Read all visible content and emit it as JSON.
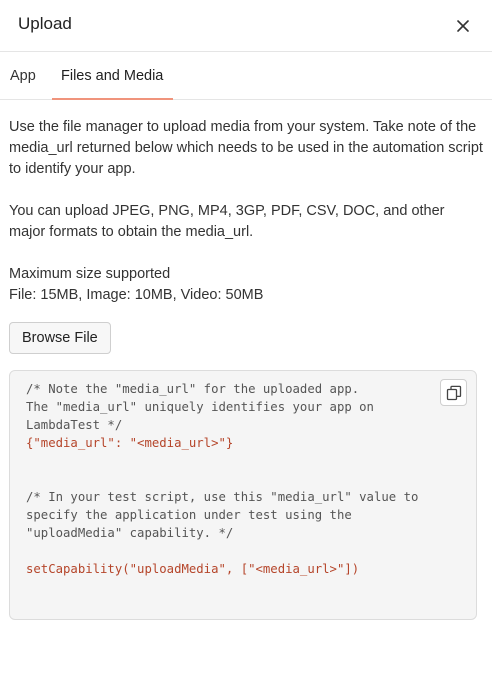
{
  "header": {
    "title": "Upload",
    "close_icon": "close-icon"
  },
  "tabs": [
    {
      "label": "App",
      "active": false
    },
    {
      "label": "Files and Media",
      "active": true
    }
  ],
  "content": {
    "paragraph1": "Use the file manager to upload media from your system. Take note of the media_url returned below which needs to be used in the automation script to identify your app.",
    "paragraph2": "You can upload JPEG, PNG, MP4, 3GP, PDF, CSV, DOC, and other major formats to obtain the media_url.",
    "max_size_label": "Maximum size supported",
    "max_size_values": "File: 15MB, Image: 10MB, Video: 50MB",
    "browse_label": "Browse File"
  },
  "code_block": {
    "copy_icon": "copy-icon",
    "comment1_line1": "/* Note the \"media_url\" for the uploaded app.",
    "comment1_line2": "The \"media_url\" uniquely identifies your app on",
    "comment1_line3": "LambdaTest */",
    "json_line": "{\"media_url\": \"<media_url>\"}",
    "comment2_line1": "/* In your test script, use this \"media_url\" value to",
    "comment2_line2": "specify the application under test using the",
    "comment2_line3": "\"uploadMedia\" capability. */",
    "capability_line": "setCapability(\"uploadMedia\", [\"<media_url>\"])"
  },
  "colors": {
    "accent": "#f0947c",
    "code_text": "#b5452a",
    "code_bg": "#f5f5f5"
  }
}
